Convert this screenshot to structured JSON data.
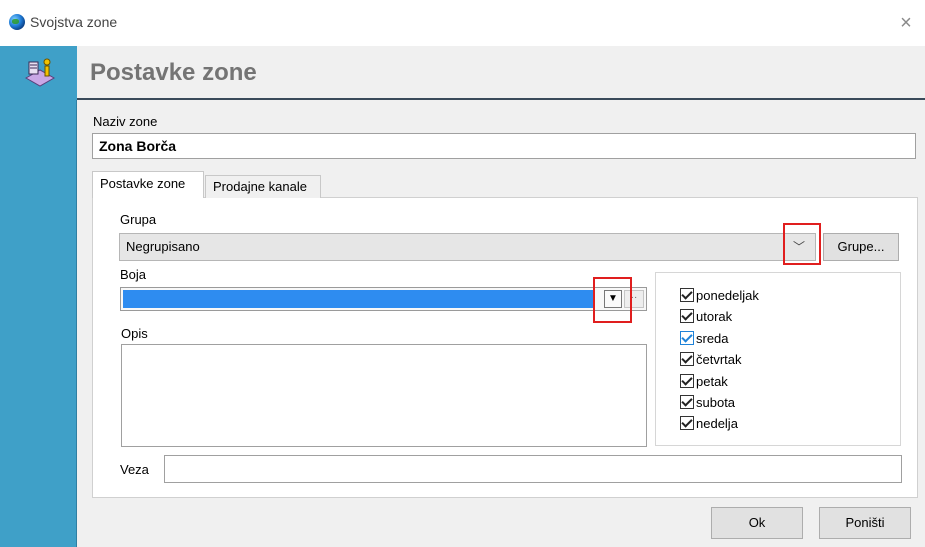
{
  "window": {
    "title": "Svojstva zone",
    "close_glyph": "×"
  },
  "header": {
    "title": "Postavke zone",
    "icon": "zone-properties-icon"
  },
  "form": {
    "naziv_label": "Naziv zone",
    "naziv_value": "Zona Borča"
  },
  "tabs": [
    {
      "label": "Postavke zone",
      "active": true
    },
    {
      "label": "Prodajne kanale",
      "active": false
    }
  ],
  "grupa": {
    "label": "Grupa",
    "value": "Negrupisano",
    "chevron": "﹀",
    "button_label": "Grupe..."
  },
  "boja": {
    "label": "Boja",
    "color": "#2e8cf0",
    "dropdown_glyph": "▼",
    "ellipsis_glyph": "··"
  },
  "opis": {
    "label": "Opis",
    "value": ""
  },
  "days": [
    {
      "label": "ponedeljak",
      "checked": true
    },
    {
      "label": "utorak",
      "checked": true
    },
    {
      "label": "sreda",
      "checked": true
    },
    {
      "label": "četvrtak",
      "checked": true
    },
    {
      "label": "petak",
      "checked": true
    },
    {
      "label": "subota",
      "checked": true
    },
    {
      "label": "nedelja",
      "checked": true
    }
  ],
  "veza": {
    "label": "Veza",
    "value": ""
  },
  "buttons": {
    "ok": "Ok",
    "cancel": "Poništi"
  },
  "highlight_color": "#e01e1e"
}
